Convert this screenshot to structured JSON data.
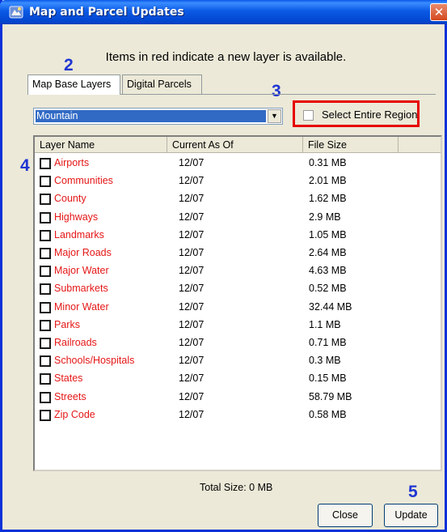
{
  "window": {
    "title": "Map and Parcel Updates",
    "close_glyph": "✕",
    "accent_color": "#0831d9",
    "icon": "app-icon"
  },
  "info_text": "Items in red indicate a new layer is available.",
  "annotations": [
    "2",
    "3",
    "4",
    "5"
  ],
  "tabs": [
    {
      "label": "Map Base Layers",
      "active": true
    },
    {
      "label": "Digital Parcels",
      "active": false
    }
  ],
  "region_select": {
    "value": "Mountain"
  },
  "select_entire_region": {
    "label": "Select Entire Region",
    "checked": false
  },
  "columns": [
    "Layer Name",
    "Current As Of",
    "File Size"
  ],
  "layers": [
    {
      "name": "Airports",
      "date": "12/07",
      "size": "0.31 MB"
    },
    {
      "name": "Communities",
      "date": "12/07",
      "size": "2.01 MB"
    },
    {
      "name": "County",
      "date": "12/07",
      "size": "1.62 MB"
    },
    {
      "name": "Highways",
      "date": "12/07",
      "size": "2.9 MB"
    },
    {
      "name": "Landmarks",
      "date": "12/07",
      "size": "1.05 MB"
    },
    {
      "name": "Major Roads",
      "date": "12/07",
      "size": "2.64 MB"
    },
    {
      "name": "Major Water",
      "date": "12/07",
      "size": "4.63 MB"
    },
    {
      "name": "Submarkets",
      "date": "12/07",
      "size": "0.52 MB"
    },
    {
      "name": "Minor Water",
      "date": "12/07",
      "size": "32.44 MB"
    },
    {
      "name": "Parks",
      "date": "12/07",
      "size": "1.1 MB"
    },
    {
      "name": "Railroads",
      "date": "12/07",
      "size": "0.71 MB"
    },
    {
      "name": "Schools/Hospitals",
      "date": "12/07",
      "size": "0.3 MB"
    },
    {
      "name": "States",
      "date": "12/07",
      "size": "0.15 MB"
    },
    {
      "name": "Streets",
      "date": "12/07",
      "size": "58.79 MB"
    },
    {
      "name": "Zip Code",
      "date": "12/07",
      "size": "0.58 MB"
    }
  ],
  "total_size": "Total Size:  0 MB",
  "buttons": {
    "close": "Close",
    "update": "Update"
  },
  "colors": {
    "new_layer": "#e51616",
    "annotation": "#1f35d2",
    "highlight_box": "#e60000"
  }
}
